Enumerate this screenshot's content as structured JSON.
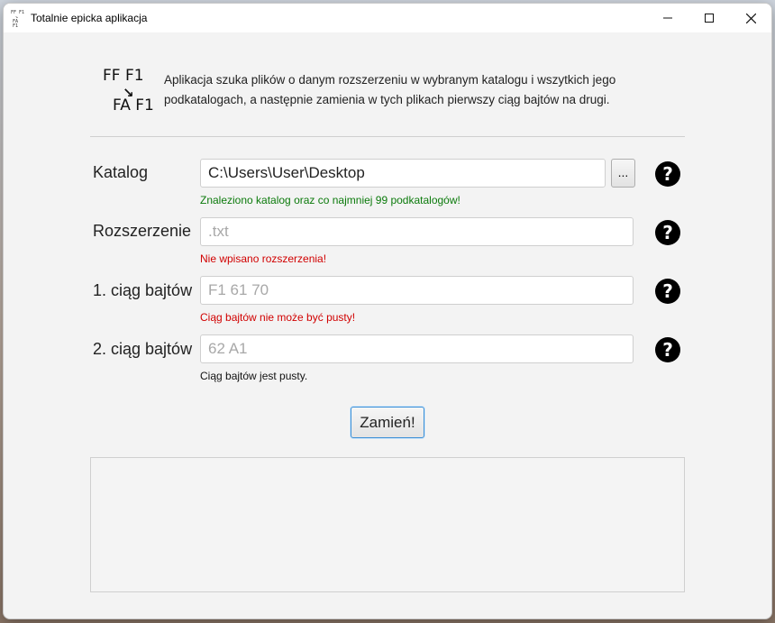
{
  "window": {
    "title": "Totalnie epicka aplikacja",
    "app_icon_lines": [
      "FF F1",
      "↘",
      "FA F1"
    ]
  },
  "logo": {
    "line1": "FF F1",
    "arrow": "↘",
    "line2": "FA F1"
  },
  "description": "Aplikacja szuka plików o danym rozszerzeniu w wybranym katalogu i wszytkich jego podkatalogach, a następnie zamienia w tych plikach pierwszy ciąg bajtów na drugi.",
  "fields": {
    "catalog": {
      "label": "Katalog",
      "value": "C:\\Users\\User\\Desktop",
      "browse_label": "...",
      "status": "Znaleziono katalog oraz co najmniej 99 podkatalogów!"
    },
    "extension": {
      "label": "Rozszerzenie",
      "placeholder": ".txt",
      "status": "Nie wpisano rozszerzenia!"
    },
    "bytes1": {
      "label": "1. ciąg bajtów",
      "placeholder": "F1 61 70",
      "status": "Ciąg bajtów nie może być pusty!"
    },
    "bytes2": {
      "label": "2. ciąg bajtów",
      "placeholder": "62 A1",
      "status": "Ciąg bajtów jest pusty."
    }
  },
  "help_icon_glyph": "?",
  "replace_button": "Zamień!",
  "colors": {
    "status_ok": "#0b7a0b",
    "status_error": "#d10000",
    "status_info": "#111111",
    "button_focus": "#3a8fd6"
  },
  "icons": {
    "minimize": "minimize-icon",
    "maximize": "maximize-icon",
    "close": "close-icon",
    "help": "help-icon"
  }
}
